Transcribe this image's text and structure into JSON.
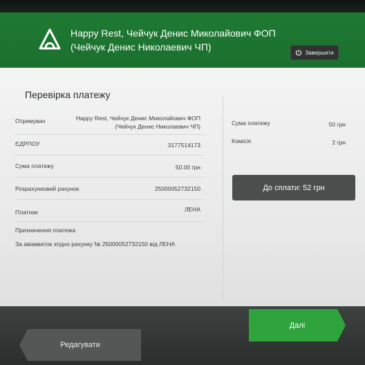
{
  "header": {
    "merchant_line1": "Happy Rest, Чейчук Денис Миколайович ФОП",
    "merchant_line2": "(Чейчук Денис Николаевич ЧП)",
    "exit_label": "Завершити"
  },
  "payment": {
    "title": "Перевірка платежу",
    "rows": [
      {
        "label": "Отримувач",
        "value_line1": "Happy Rest, Чейчук Денис Миколайович ФОП",
        "value_line2": "(Чейчук Денис Николаевич ЧП)"
      },
      {
        "label": "ЄДРПОУ",
        "value": "3177514173"
      },
      {
        "label": "Сума платежу",
        "value": "50.00 грн"
      },
      {
        "label": "Розрахунковий рахунок",
        "value": "25000052732150"
      },
      {
        "label": "Платник",
        "value": "ЛЕНА"
      }
    ],
    "purpose_label": "Призначення платежа",
    "purpose_value": "За авіаквиток згідно рахунку № 25000052732150 від ЛЕНА"
  },
  "summary": {
    "amount_label": "Сума платежу",
    "amount_value": "50 грн",
    "fee_label": "Комісія",
    "fee_value": "2 грн",
    "to_pay": "До сплати: 52 грн"
  },
  "footer": {
    "edit_label": "Редагувати",
    "next_label": "Далі"
  },
  "colors": {
    "brand_green": "#1f7a33",
    "next_button": "#2fa33c",
    "dark_box": "#4a4e4c"
  },
  "icons": {
    "logo": "privatbank-logo-icon",
    "exit": "power-icon"
  }
}
